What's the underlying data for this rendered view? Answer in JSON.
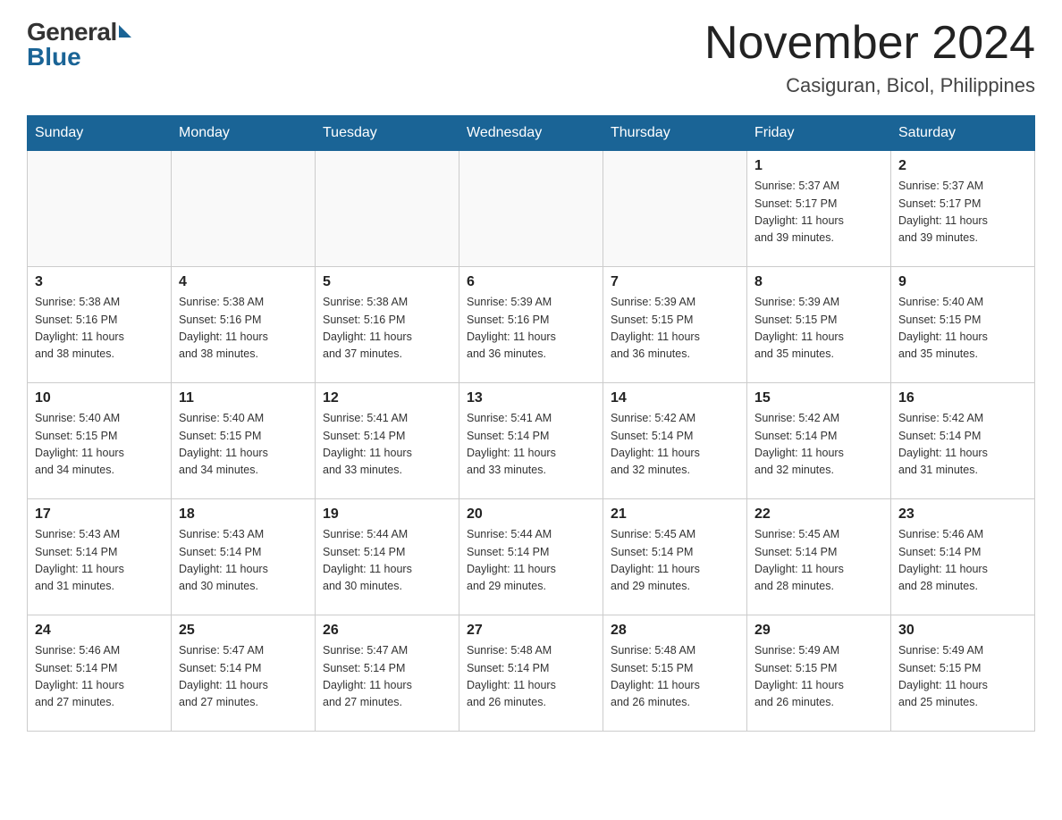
{
  "header": {
    "logo_general": "General",
    "logo_blue": "Blue",
    "month_title": "November 2024",
    "location": "Casiguran, Bicol, Philippines"
  },
  "days_of_week": [
    "Sunday",
    "Monday",
    "Tuesday",
    "Wednesday",
    "Thursday",
    "Friday",
    "Saturday"
  ],
  "weeks": [
    [
      {
        "day": "",
        "info": ""
      },
      {
        "day": "",
        "info": ""
      },
      {
        "day": "",
        "info": ""
      },
      {
        "day": "",
        "info": ""
      },
      {
        "day": "",
        "info": ""
      },
      {
        "day": "1",
        "info": "Sunrise: 5:37 AM\nSunset: 5:17 PM\nDaylight: 11 hours\nand 39 minutes."
      },
      {
        "day": "2",
        "info": "Sunrise: 5:37 AM\nSunset: 5:17 PM\nDaylight: 11 hours\nand 39 minutes."
      }
    ],
    [
      {
        "day": "3",
        "info": "Sunrise: 5:38 AM\nSunset: 5:16 PM\nDaylight: 11 hours\nand 38 minutes."
      },
      {
        "day": "4",
        "info": "Sunrise: 5:38 AM\nSunset: 5:16 PM\nDaylight: 11 hours\nand 38 minutes."
      },
      {
        "day": "5",
        "info": "Sunrise: 5:38 AM\nSunset: 5:16 PM\nDaylight: 11 hours\nand 37 minutes."
      },
      {
        "day": "6",
        "info": "Sunrise: 5:39 AM\nSunset: 5:16 PM\nDaylight: 11 hours\nand 36 minutes."
      },
      {
        "day": "7",
        "info": "Sunrise: 5:39 AM\nSunset: 5:15 PM\nDaylight: 11 hours\nand 36 minutes."
      },
      {
        "day": "8",
        "info": "Sunrise: 5:39 AM\nSunset: 5:15 PM\nDaylight: 11 hours\nand 35 minutes."
      },
      {
        "day": "9",
        "info": "Sunrise: 5:40 AM\nSunset: 5:15 PM\nDaylight: 11 hours\nand 35 minutes."
      }
    ],
    [
      {
        "day": "10",
        "info": "Sunrise: 5:40 AM\nSunset: 5:15 PM\nDaylight: 11 hours\nand 34 minutes."
      },
      {
        "day": "11",
        "info": "Sunrise: 5:40 AM\nSunset: 5:15 PM\nDaylight: 11 hours\nand 34 minutes."
      },
      {
        "day": "12",
        "info": "Sunrise: 5:41 AM\nSunset: 5:14 PM\nDaylight: 11 hours\nand 33 minutes."
      },
      {
        "day": "13",
        "info": "Sunrise: 5:41 AM\nSunset: 5:14 PM\nDaylight: 11 hours\nand 33 minutes."
      },
      {
        "day": "14",
        "info": "Sunrise: 5:42 AM\nSunset: 5:14 PM\nDaylight: 11 hours\nand 32 minutes."
      },
      {
        "day": "15",
        "info": "Sunrise: 5:42 AM\nSunset: 5:14 PM\nDaylight: 11 hours\nand 32 minutes."
      },
      {
        "day": "16",
        "info": "Sunrise: 5:42 AM\nSunset: 5:14 PM\nDaylight: 11 hours\nand 31 minutes."
      }
    ],
    [
      {
        "day": "17",
        "info": "Sunrise: 5:43 AM\nSunset: 5:14 PM\nDaylight: 11 hours\nand 31 minutes."
      },
      {
        "day": "18",
        "info": "Sunrise: 5:43 AM\nSunset: 5:14 PM\nDaylight: 11 hours\nand 30 minutes."
      },
      {
        "day": "19",
        "info": "Sunrise: 5:44 AM\nSunset: 5:14 PM\nDaylight: 11 hours\nand 30 minutes."
      },
      {
        "day": "20",
        "info": "Sunrise: 5:44 AM\nSunset: 5:14 PM\nDaylight: 11 hours\nand 29 minutes."
      },
      {
        "day": "21",
        "info": "Sunrise: 5:45 AM\nSunset: 5:14 PM\nDaylight: 11 hours\nand 29 minutes."
      },
      {
        "day": "22",
        "info": "Sunrise: 5:45 AM\nSunset: 5:14 PM\nDaylight: 11 hours\nand 28 minutes."
      },
      {
        "day": "23",
        "info": "Sunrise: 5:46 AM\nSunset: 5:14 PM\nDaylight: 11 hours\nand 28 minutes."
      }
    ],
    [
      {
        "day": "24",
        "info": "Sunrise: 5:46 AM\nSunset: 5:14 PM\nDaylight: 11 hours\nand 27 minutes."
      },
      {
        "day": "25",
        "info": "Sunrise: 5:47 AM\nSunset: 5:14 PM\nDaylight: 11 hours\nand 27 minutes."
      },
      {
        "day": "26",
        "info": "Sunrise: 5:47 AM\nSunset: 5:14 PM\nDaylight: 11 hours\nand 27 minutes."
      },
      {
        "day": "27",
        "info": "Sunrise: 5:48 AM\nSunset: 5:14 PM\nDaylight: 11 hours\nand 26 minutes."
      },
      {
        "day": "28",
        "info": "Sunrise: 5:48 AM\nSunset: 5:15 PM\nDaylight: 11 hours\nand 26 minutes."
      },
      {
        "day": "29",
        "info": "Sunrise: 5:49 AM\nSunset: 5:15 PM\nDaylight: 11 hours\nand 26 minutes."
      },
      {
        "day": "30",
        "info": "Sunrise: 5:49 AM\nSunset: 5:15 PM\nDaylight: 11 hours\nand 25 minutes."
      }
    ]
  ]
}
